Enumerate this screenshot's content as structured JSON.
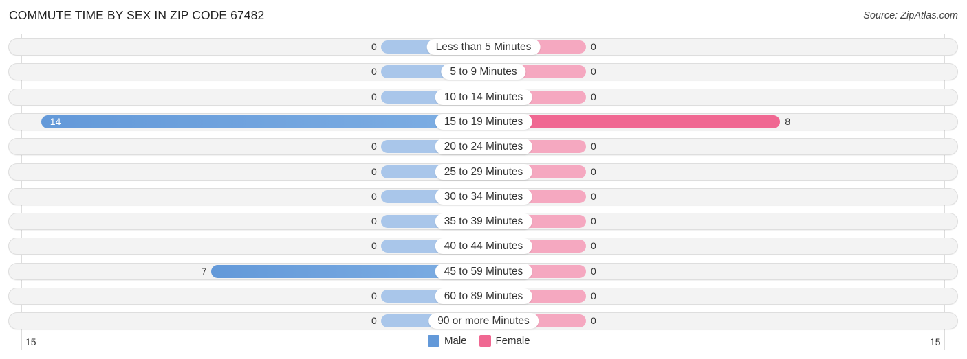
{
  "chart_data": {
    "type": "bar",
    "orientation": "horizontal-diverging",
    "title": "COMMUTE TIME BY SEX IN ZIP CODE 67482",
    "source": "Source: ZipAtlas.com",
    "categories": [
      "Less than 5 Minutes",
      "5 to 9 Minutes",
      "10 to 14 Minutes",
      "15 to 19 Minutes",
      "20 to 24 Minutes",
      "25 to 29 Minutes",
      "30 to 34 Minutes",
      "35 to 39 Minutes",
      "40 to 44 Minutes",
      "45 to 59 Minutes",
      "60 to 89 Minutes",
      "90 or more Minutes"
    ],
    "series": [
      {
        "name": "Male",
        "color": "#6399d9",
        "light_color": "#a9c6ea",
        "values": [
          0,
          0,
          0,
          14,
          0,
          0,
          0,
          0,
          0,
          7,
          0,
          0
        ]
      },
      {
        "name": "Female",
        "color": "#f06892",
        "light_color": "#f5a8c0",
        "values": [
          0,
          0,
          0,
          8,
          0,
          0,
          0,
          0,
          0,
          0,
          0,
          0
        ]
      }
    ],
    "axis": {
      "left_tick": "15",
      "right_tick": "15",
      "range": [
        15,
        15
      ]
    },
    "legend": {
      "placement": "bottom-center",
      "items": [
        "Male",
        "Female"
      ]
    }
  }
}
